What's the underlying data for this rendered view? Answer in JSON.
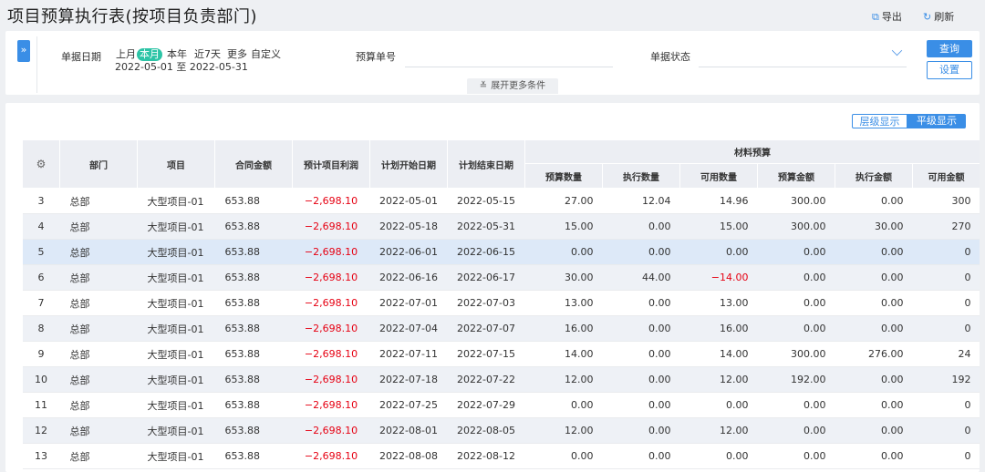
{
  "page": {
    "title": "项目预算执行表(按项目负责部门)",
    "export_label": "导出",
    "refresh_label": "刷新"
  },
  "filters": {
    "toggle_icon": "»",
    "date_label": "单据日期",
    "quick_options": [
      "上月",
      "本月",
      "本年",
      "近7天",
      "更多",
      "自定义"
    ],
    "active_option": "本月",
    "date_range": "2022-05-01 至 2022-05-31",
    "budget_no_label": "预算单号",
    "budget_no_value": "",
    "status_label": "单据状态",
    "status_value": "",
    "query_label": "查询",
    "settings_label": "设置",
    "expand_label": "展开更多条件",
    "expand_icon": "≚"
  },
  "view_toggle": {
    "tree_label": "层级显示",
    "flat_label": "平级显示",
    "active": "平级显示"
  },
  "table": {
    "headers": {
      "settings_icon": "⚙",
      "dept": "部门",
      "project": "项目",
      "contract": "合同金额",
      "profit": "预计项目利润",
      "start": "计划开始日期",
      "end": "计划结束日期",
      "group": "材料预算",
      "budget_qty": "预算数量",
      "exec_qty": "执行数量",
      "avail_qty": "可用数量",
      "budget_amt": "预算金额",
      "exec_amt": "执行金额",
      "avail_amt": "可用金额"
    },
    "rows": [
      [
        "3",
        "总部",
        "大型项目-01",
        "653.88",
        "−2,698.10",
        "2022-05-01",
        "2022-05-15",
        "27.00",
        "12.04",
        "14.96",
        "300.00",
        "0.00",
        "300"
      ],
      [
        "4",
        "总部",
        "大型项目-01",
        "653.88",
        "−2,698.10",
        "2022-05-18",
        "2022-05-31",
        "15.00",
        "0.00",
        "15.00",
        "300.00",
        "30.00",
        "270"
      ],
      [
        "5",
        "总部",
        "大型项目-01",
        "653.88",
        "−2,698.10",
        "2022-06-01",
        "2022-06-15",
        "0.00",
        "0.00",
        "0.00",
        "0.00",
        "0.00",
        "0"
      ],
      [
        "6",
        "总部",
        "大型项目-01",
        "653.88",
        "−2,698.10",
        "2022-06-16",
        "2022-06-17",
        "30.00",
        "44.00",
        "−14.00",
        "0.00",
        "0.00",
        "0"
      ],
      [
        "7",
        "总部",
        "大型项目-01",
        "653.88",
        "−2,698.10",
        "2022-07-01",
        "2022-07-03",
        "13.00",
        "0.00",
        "13.00",
        "0.00",
        "0.00",
        "0"
      ],
      [
        "8",
        "总部",
        "大型项目-01",
        "653.88",
        "−2,698.10",
        "2022-07-04",
        "2022-07-07",
        "16.00",
        "0.00",
        "16.00",
        "0.00",
        "0.00",
        "0"
      ],
      [
        "9",
        "总部",
        "大型项目-01",
        "653.88",
        "−2,698.10",
        "2022-07-11",
        "2022-07-15",
        "14.00",
        "0.00",
        "14.00",
        "300.00",
        "276.00",
        "24"
      ],
      [
        "10",
        "总部",
        "大型项目-01",
        "653.88",
        "−2,698.10",
        "2022-07-18",
        "2022-07-22",
        "12.00",
        "0.00",
        "12.00",
        "192.00",
        "0.00",
        "192"
      ],
      [
        "11",
        "总部",
        "大型项目-01",
        "653.88",
        "−2,698.10",
        "2022-07-25",
        "2022-07-29",
        "0.00",
        "0.00",
        "0.00",
        "0.00",
        "0.00",
        "0"
      ],
      [
        "12",
        "总部",
        "大型项目-01",
        "653.88",
        "−2,698.10",
        "2022-08-01",
        "2022-08-05",
        "12.00",
        "0.00",
        "12.00",
        "0.00",
        "0.00",
        "0"
      ],
      [
        "13",
        "总部",
        "大型项目-01",
        "653.88",
        "−2,698.10",
        "2022-08-08",
        "2022-08-12",
        "0.00",
        "0.00",
        "0.00",
        "0.00",
        "0.00",
        "0"
      ]
    ],
    "selected_row_index": 2,
    "negative_color": "#e60012"
  },
  "colors": {
    "accent": "#3a8ee6",
    "active_tag": "#2cc4a6",
    "negative": "#e60012"
  }
}
